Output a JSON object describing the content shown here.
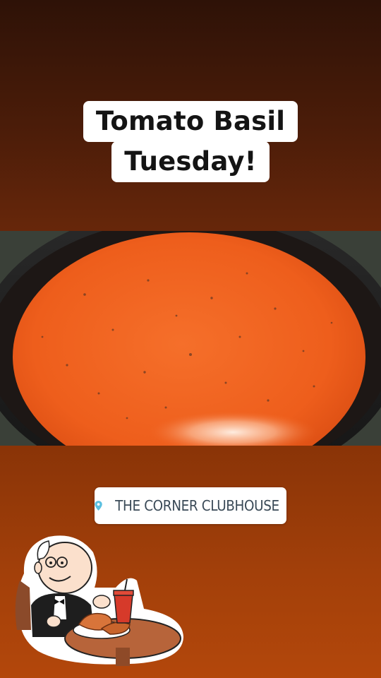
{
  "story": {
    "title_line_1": "Tomato Basil",
    "title_line_2": "Tuesday!",
    "location_label": "THE CORNER CLUBHOUSE",
    "background_top_color": "#2e1207",
    "background_bottom_color": "#b3470b"
  },
  "photo": {
    "subject": "tomato basil soup in a pot",
    "soup_color": "#f0621e"
  },
  "stickers": {
    "location_icon": "map-pin-icon",
    "accent_color": "#5bc0e0",
    "diner_sticker": "cartoon-diner-eating-chicken"
  }
}
